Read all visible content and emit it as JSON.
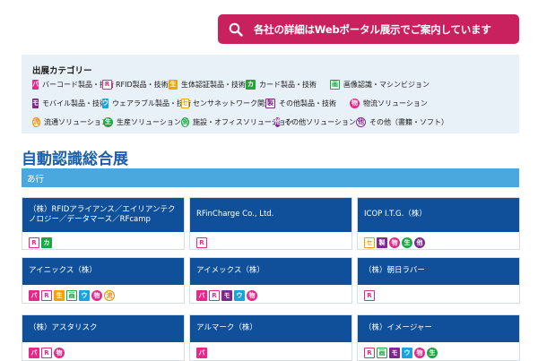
{
  "portal_button": {
    "label": "各社の詳細はWebポータル展示でご案内しています",
    "icon": "search-icon",
    "color": "#c8215e"
  },
  "legend": {
    "title": "出展カテゴリー",
    "items": [
      {
        "mark": "バ",
        "label": "バーコード製品・技術",
        "color": "#e8278b",
        "style": "fill"
      },
      {
        "mark": "R",
        "label": "RFID製品・技術",
        "color": "#e8278b",
        "style": "outline"
      },
      {
        "mark": "生",
        "label": "生体認証製品・技術",
        "color": "#f5a200",
        "style": "fill"
      },
      {
        "mark": "カ",
        "label": "カード製品・技術",
        "color": "#1ea643",
        "style": "fill"
      },
      {
        "mark": "画",
        "label": "画像認識・マシンビジョン",
        "color": "#1ea643",
        "style": "outline"
      },
      {
        "mark": "モ",
        "label": "モバイル製品・技術",
        "color": "#7b2a8c",
        "style": "fill"
      },
      {
        "mark": "ウ",
        "label": "ウェアラブル製品・技術",
        "color": "#1aa3dc",
        "style": "fill"
      },
      {
        "mark": "セ",
        "label": "センサネットワーク関連",
        "color": "#f5a200",
        "style": "outline"
      },
      {
        "mark": "製",
        "label": "その他製品・技術",
        "color": "#7b2a8c",
        "style": "outline"
      },
      {
        "mark": "物",
        "label": "物流ソリューション",
        "color": "#e8278b",
        "style": "circle"
      },
      {
        "mark": "流",
        "label": "流通ソリューション",
        "color": "#f08c00",
        "style": "circle-outline"
      },
      {
        "mark": "生",
        "label": "生産ソリューション",
        "color": "#1ea643",
        "style": "circle"
      },
      {
        "mark": "施",
        "label": "施設・オフィスソリューション",
        "color": "#1ea643",
        "style": "circle-outline"
      },
      {
        "mark": "他",
        "label": "その他ソリューション",
        "color": "#7b2a8c",
        "style": "circle"
      },
      {
        "mark": "他",
        "label": "その他（書籍・ソフト）",
        "color": "#7b2a8c",
        "style": "circle-outline"
      }
    ]
  },
  "section": {
    "title": "自動認識総合展",
    "subheading": "あ行"
  },
  "cards": [
    {
      "name": "（株）RFIDアライアンス／エイリアンテクノロジー／データマース／RFcamp",
      "badges": [
        {
          "mark": "R",
          "color": "#e8278b",
          "style": "outline"
        },
        {
          "mark": "カ",
          "color": "#1ea643",
          "style": "fill"
        }
      ]
    },
    {
      "name": "RFinCharge Co., Ltd.",
      "badges": [
        {
          "mark": "R",
          "color": "#e8278b",
          "style": "outline"
        }
      ]
    },
    {
      "name": "ICOP I.T.G.（株）",
      "badges": [
        {
          "mark": "セ",
          "color": "#f5a200",
          "style": "outline"
        },
        {
          "mark": "製",
          "color": "#7b2a8c",
          "style": "fill"
        },
        {
          "mark": "物",
          "color": "#e8278b",
          "style": "circle"
        },
        {
          "mark": "生",
          "color": "#1ea643",
          "style": "circle"
        },
        {
          "mark": "他",
          "color": "#7b2a8c",
          "style": "circle"
        }
      ]
    },
    {
      "name": "アイニックス（株）",
      "badges": [
        {
          "mark": "バ",
          "color": "#e8278b",
          "style": "fill"
        },
        {
          "mark": "R",
          "color": "#e8278b",
          "style": "outline"
        },
        {
          "mark": "生",
          "color": "#f5a200",
          "style": "fill"
        },
        {
          "mark": "画",
          "color": "#1ea643",
          "style": "outline"
        },
        {
          "mark": "ウ",
          "color": "#1aa3dc",
          "style": "fill"
        },
        {
          "mark": "物",
          "color": "#e8278b",
          "style": "circle"
        },
        {
          "mark": "流",
          "color": "#f08c00",
          "style": "circle-outline"
        }
      ]
    },
    {
      "name": "アイメックス（株）",
      "badges": [
        {
          "mark": "バ",
          "color": "#e8278b",
          "style": "fill"
        },
        {
          "mark": "R",
          "color": "#e8278b",
          "style": "outline"
        },
        {
          "mark": "モ",
          "color": "#7b2a8c",
          "style": "fill"
        },
        {
          "mark": "ウ",
          "color": "#1aa3dc",
          "style": "fill"
        },
        {
          "mark": "物",
          "color": "#e8278b",
          "style": "circle"
        }
      ]
    },
    {
      "name": "（株）朝日ラバー",
      "badges": [
        {
          "mark": "R",
          "color": "#e8278b",
          "style": "outline"
        }
      ]
    },
    {
      "name": "（株）アスタリスク",
      "badges": [
        {
          "mark": "バ",
          "color": "#e8278b",
          "style": "fill"
        },
        {
          "mark": "R",
          "color": "#e8278b",
          "style": "outline"
        },
        {
          "mark": "物",
          "color": "#e8278b",
          "style": "circle"
        }
      ]
    },
    {
      "name": "アルマーク（株）",
      "badges": [
        {
          "mark": "バ",
          "color": "#e8278b",
          "style": "fill"
        }
      ]
    },
    {
      "name": "（株）イメージャー",
      "badges": [
        {
          "mark": "R",
          "color": "#e8278b",
          "style": "outline"
        },
        {
          "mark": "画",
          "color": "#1ea643",
          "style": "outline"
        },
        {
          "mark": "モ",
          "color": "#7b2a8c",
          "style": "fill"
        },
        {
          "mark": "ウ",
          "color": "#1aa3dc",
          "style": "fill"
        },
        {
          "mark": "物",
          "color": "#e8278b",
          "style": "circle"
        },
        {
          "mark": "生",
          "color": "#1ea643",
          "style": "circle"
        }
      ]
    }
  ]
}
